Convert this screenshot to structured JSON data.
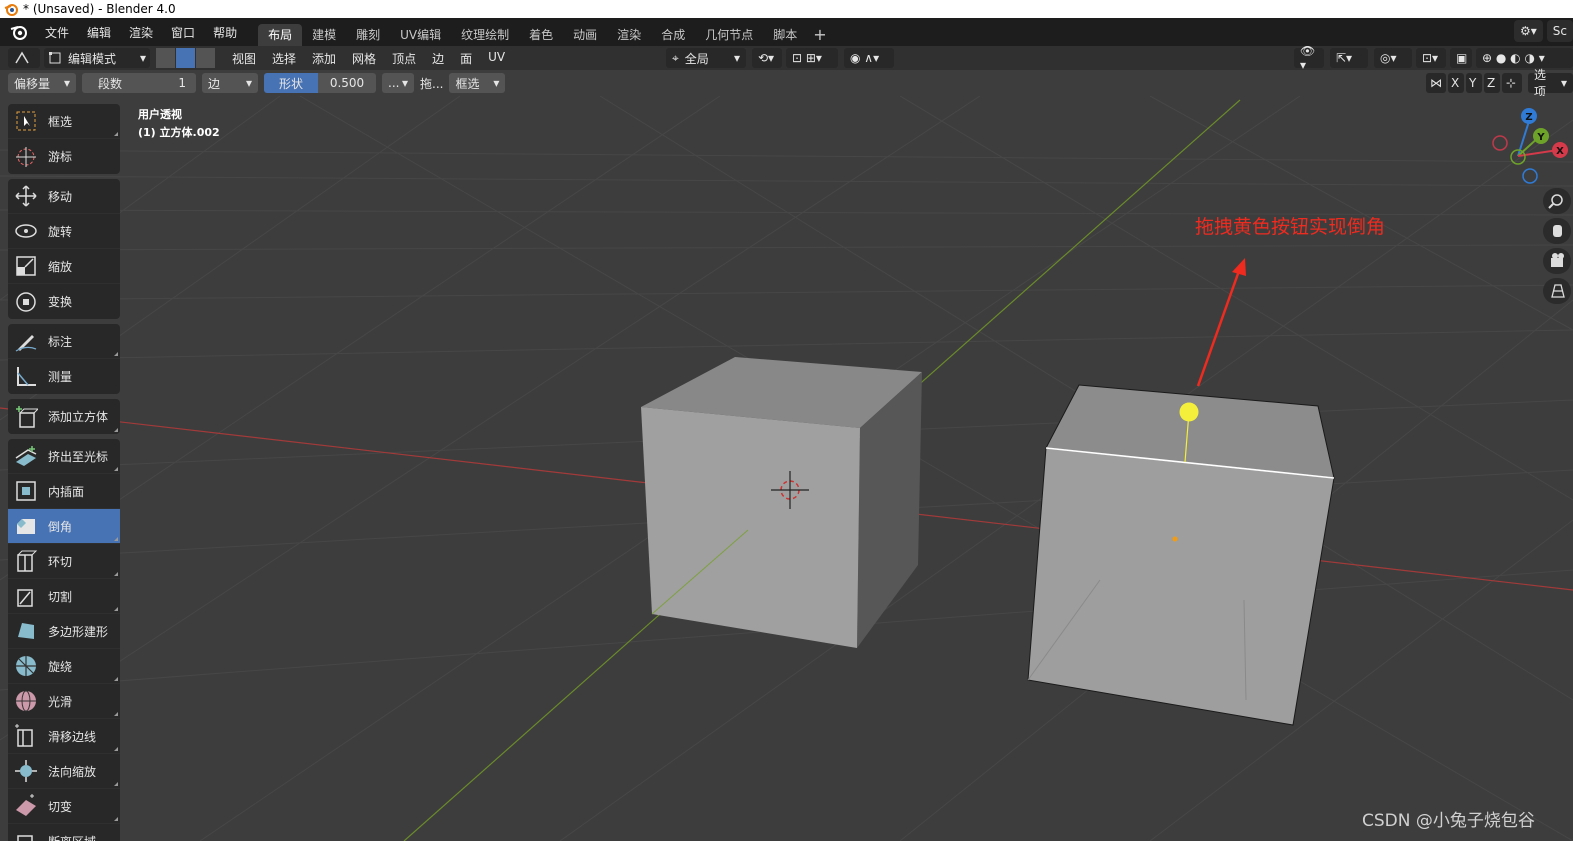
{
  "window": {
    "title": "* (Unsaved) - Blender 4.0"
  },
  "menu": [
    "文件",
    "编辑",
    "渲染",
    "窗口",
    "帮助"
  ],
  "workspaces": [
    "布局",
    "建模",
    "雕刻",
    "UV编辑",
    "纹理绘制",
    "着色",
    "动画",
    "渲染",
    "合成",
    "几何节点",
    "脚本"
  ],
  "workspace_add": "+",
  "scene_label": "Sc",
  "header": {
    "mode": "编辑模式",
    "menus": [
      "视图",
      "选择",
      "添加",
      "网格",
      "顶点",
      "边",
      "面",
      "UV"
    ],
    "transform_orientation": "全局"
  },
  "operator": {
    "offset_type": "偏移量",
    "segments_label": "段数",
    "segments_value": "1",
    "affect": "边",
    "shape_label": "形状",
    "shape_value": "0.500",
    "more": "...",
    "drag": "拖...",
    "select_mode": "框选",
    "axes": [
      "X",
      "Y",
      "Z"
    ],
    "options": "选项"
  },
  "viewport": {
    "view_name": "用户透视",
    "object_name": "(1) 立方体.002",
    "gizmo_axes": [
      "Z",
      "Y",
      "X"
    ]
  },
  "tools": [
    [
      "框选",
      "游标"
    ],
    [
      "移动",
      "旋转",
      "缩放",
      "变换"
    ],
    [
      "标注",
      "测量"
    ],
    [
      "添加立方体"
    ],
    [
      "挤出至光标",
      "内插面",
      "倒角",
      "环切",
      "切割",
      "多边形建形",
      "旋绕",
      "光滑",
      "滑移边线",
      "法向缩放",
      "切变",
      "断离区域"
    ]
  ],
  "active_tool": "倒角",
  "annotation": "拖拽黄色按钮实现倒角",
  "watermark": "CSDN @小兔子烧包谷",
  "colors": {
    "accent": "#4772b3",
    "annotation": "#ef2a1f",
    "handle": "#f4ef3a"
  }
}
